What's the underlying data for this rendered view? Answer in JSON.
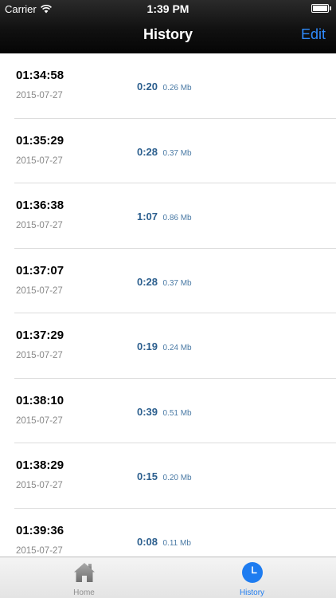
{
  "status": {
    "carrier": "Carrier",
    "time": "1:39 PM"
  },
  "nav": {
    "title": "History",
    "edit_label": "Edit"
  },
  "history": [
    {
      "time": "01:34:58",
      "date": "2015-07-27",
      "duration": "0:20",
      "size": "0.26 Mb"
    },
    {
      "time": "01:35:29",
      "date": "2015-07-27",
      "duration": "0:28",
      "size": "0.37 Mb"
    },
    {
      "time": "01:36:38",
      "date": "2015-07-27",
      "duration": "1:07",
      "size": "0.86 Mb"
    },
    {
      "time": "01:37:07",
      "date": "2015-07-27",
      "duration": "0:28",
      "size": "0.37 Mb"
    },
    {
      "time": "01:37:29",
      "date": "2015-07-27",
      "duration": "0:19",
      "size": "0.24 Mb"
    },
    {
      "time": "01:38:10",
      "date": "2015-07-27",
      "duration": "0:39",
      "size": "0.51 Mb"
    },
    {
      "time": "01:38:29",
      "date": "2015-07-27",
      "duration": "0:15",
      "size": "0.20 Mb"
    },
    {
      "time": "01:39:36",
      "date": "2015-07-27",
      "duration": "0:08",
      "size": "0.11 Mb"
    }
  ],
  "tabs": [
    {
      "label": "Home",
      "icon": "home-icon",
      "active": false
    },
    {
      "label": "History",
      "icon": "clock-icon",
      "active": true
    }
  ],
  "colors": {
    "accent": "#2f8cff",
    "tab_active": "#1e7cf0",
    "duration_text": "#2c5f8e"
  }
}
